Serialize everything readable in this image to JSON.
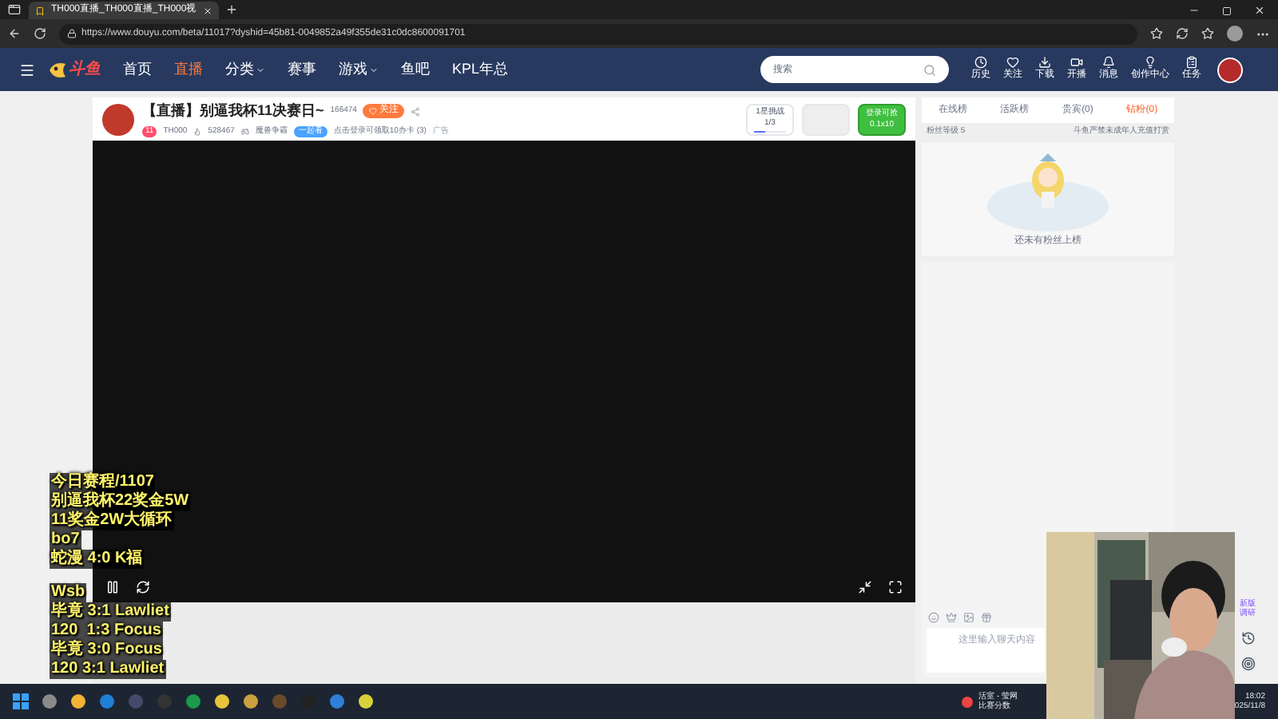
{
  "browser": {
    "tab_title": "TH000直播_TH000直播_TH000视",
    "url": "https://www.douyu.com/beta/11017?dyshid=45b81-0049852a49f355de31c0dc8600091701"
  },
  "nav": {
    "logo": "斗鱼",
    "items": [
      {
        "label": "首页",
        "selected": false,
        "dropdown": false
      },
      {
        "label": "直播",
        "selected": true,
        "dropdown": false
      },
      {
        "label": "分类",
        "selected": false,
        "dropdown": true
      },
      {
        "label": "赛事",
        "selected": false,
        "dropdown": false
      },
      {
        "label": "游戏",
        "selected": false,
        "dropdown": true
      },
      {
        "label": "鱼吧",
        "selected": false,
        "dropdown": false
      },
      {
        "label": "KPL年总",
        "selected": false,
        "dropdown": false
      }
    ],
    "search": {
      "placeholder": "搜索"
    },
    "actions": [
      {
        "kind": "history",
        "label": "历史"
      },
      {
        "kind": "follow",
        "label": "关注"
      },
      {
        "kind": "download",
        "label": "下载"
      },
      {
        "kind": "live",
        "label": "开播"
      },
      {
        "kind": "message",
        "label": "消息"
      },
      {
        "kind": "creator",
        "label": "创作中心"
      },
      {
        "kind": "task",
        "label": "任务"
      }
    ]
  },
  "room": {
    "title": "【直播】别逼我杯11决赛日~",
    "followers": "166474",
    "follow_button": "关注",
    "level": "11",
    "streamer": "TH000",
    "heat": "528467",
    "category": "魔兽争霸",
    "tag": "一起看",
    "promo": "点击登录可领取10办卡 (3)",
    "ad": "广告",
    "challenge": {
      "label": "1星挑战",
      "count": "1/3",
      "level": 0.33
    },
    "gift": {
      "line1": "登录可抢",
      "line2": "0.1x10"
    }
  },
  "overlay_text": [
    [
      "今日赛程/1107",
      "别逼我杯22奖金5W",
      "11奖金2W大循环",
      "bo7",
      "蛇漫 4:0 K福"
    ],
    [
      "Wsb",
      "毕竟 3:1 Lawliet",
      "120  1:3 Focus",
      "毕竟 3:0 Focus",
      "120 3:1 Lawliet"
    ]
  ],
  "side": {
    "tabs": [
      {
        "label": "在线榜",
        "selected": false
      },
      {
        "label": "活跃榜",
        "selected": false
      },
      {
        "label": "贵宾(0)",
        "selected": false
      },
      {
        "label": "钻粉(0)",
        "selected": true
      }
    ],
    "fan_level": "粉丝等级 5",
    "notice": "斗鱼严禁未成年人充值打赏",
    "empty": "还未有粉丝上榜",
    "chat_placeholder": "这里输入聊天内容"
  },
  "survey": "新版调研",
  "taskbar": {
    "notice_title": "活室 - 莹网",
    "notice_sub": "比赛分数",
    "time": "18:02",
    "date": "025/11/8"
  }
}
